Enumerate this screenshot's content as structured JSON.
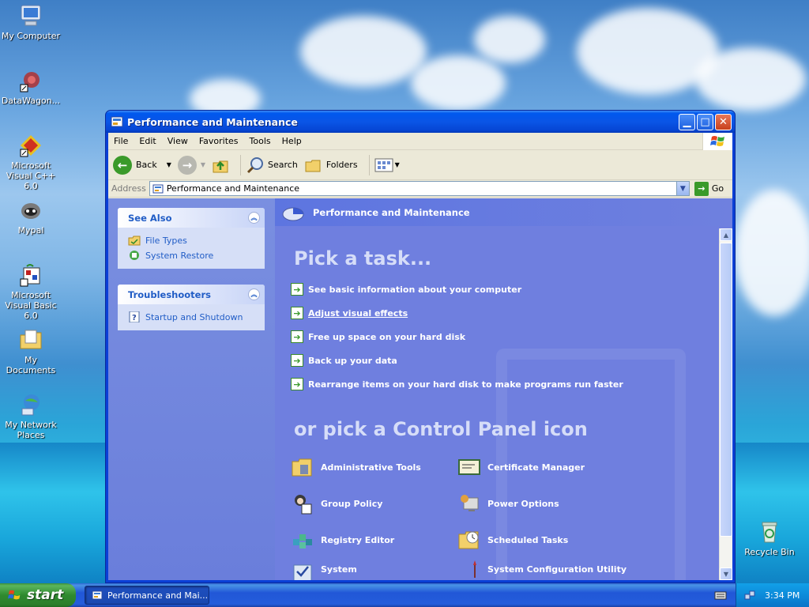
{
  "desktop": {
    "icons": [
      {
        "label": "My Computer",
        "icon": "my-computer-icon"
      },
      {
        "label": "DataWagon...",
        "icon": "datawagon-icon"
      },
      {
        "label": "Microsoft Visual C++ 6.0",
        "icon": "visual-cpp-icon"
      },
      {
        "label": "Mypal",
        "icon": "mypal-icon"
      },
      {
        "label": "Microsoft Visual Basic 6.0",
        "icon": "visual-basic-icon"
      },
      {
        "label": "My Documents",
        "icon": "my-documents-icon"
      },
      {
        "label": "My Network Places",
        "icon": "network-places-icon"
      },
      {
        "label": "Recycle Bin",
        "icon": "recycle-bin-icon"
      }
    ]
  },
  "window": {
    "title": "Performance and Maintenance",
    "menu": [
      "File",
      "Edit",
      "View",
      "Favorites",
      "Tools",
      "Help"
    ],
    "toolbar": {
      "back": "Back",
      "search": "Search",
      "folders": "Folders"
    },
    "address": {
      "label": "Address",
      "value": "Performance and Maintenance",
      "go": "Go"
    }
  },
  "sidebar": {
    "see_also": {
      "title": "See Also",
      "items": [
        "File Types",
        "System Restore"
      ]
    },
    "troubleshooters": {
      "title": "Troubleshooters",
      "items": [
        "Startup and Shutdown"
      ]
    }
  },
  "main": {
    "header": "Performance and Maintenance",
    "pick_task": "Pick a task...",
    "tasks": [
      "See basic information about your computer",
      "Adjust visual effects",
      "Free up space on your hard disk",
      "Back up your data",
      "Rearrange items on your hard disk to make programs run faster"
    ],
    "pick_icon": "or pick a Control Panel icon",
    "control_panel": [
      "Administrative Tools",
      "Certificate Manager",
      "Group Policy",
      "Power Options",
      "Registry Editor",
      "Scheduled Tasks",
      "System",
      "System Configuration Utility"
    ]
  },
  "taskbar": {
    "start": "start",
    "task": "Performance and Mai...",
    "clock": "3:34 PM"
  },
  "colors": {
    "accent": "#0a55e6",
    "task_pane": "#6f7fdf",
    "start_green": "#2f8a2f"
  }
}
